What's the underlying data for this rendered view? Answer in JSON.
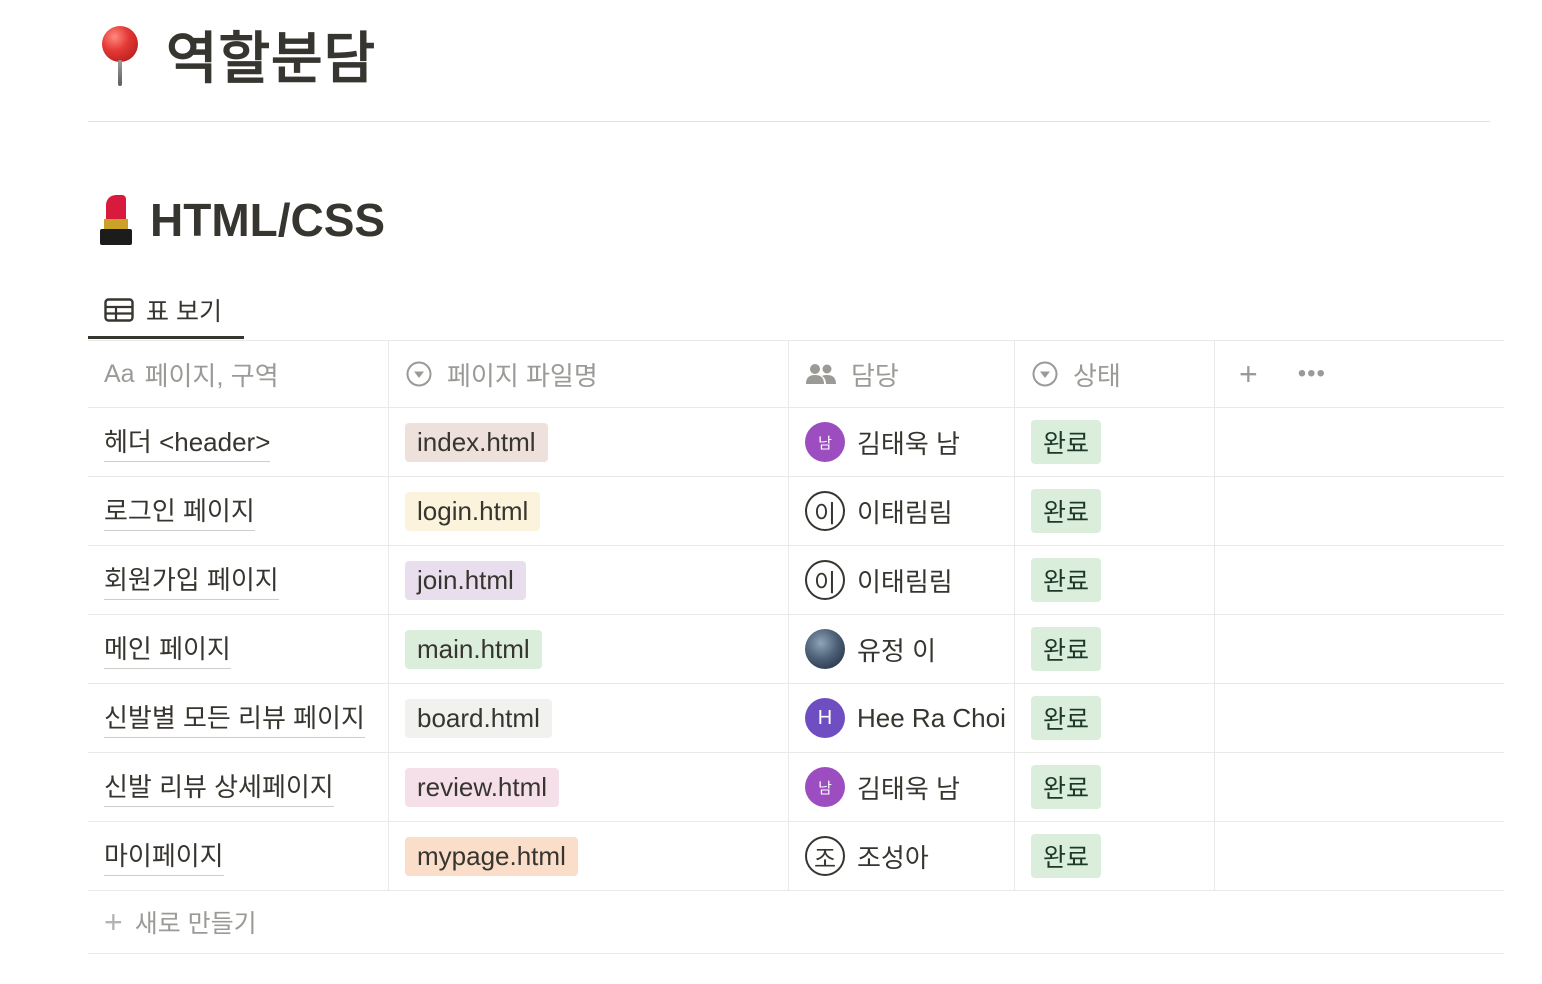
{
  "page": {
    "emoji": "pushpin-emoji",
    "title": "역할분담"
  },
  "section": {
    "emoji": "lipstick-emoji",
    "title": "HTML/CSS"
  },
  "view": {
    "tab_label": "표 보기",
    "tab_icon": "table-icon"
  },
  "table": {
    "columns": [
      {
        "prefix": "Aa",
        "label": "페이지, 구역",
        "icon": "text-property-icon"
      },
      {
        "label": "페이지 파일명",
        "icon": "select-property-icon"
      },
      {
        "label": "담당",
        "icon": "people-property-icon"
      },
      {
        "label": "상태",
        "icon": "select-property-icon"
      }
    ],
    "add_column_label": "+",
    "more_label": "•••",
    "rows": [
      {
        "title": "헤더 <header>",
        "file": "index.html",
        "file_color": "#eee0da",
        "assignee": "김태욱 남",
        "avatar_text": "남",
        "avatar_style": "purple",
        "status": "완료"
      },
      {
        "title": "로그인 페이지",
        "file": "login.html",
        "file_color": "#fbf3db",
        "assignee": "이태림림",
        "avatar_text": "이",
        "avatar_style": "outline",
        "status": "완료"
      },
      {
        "title": "회원가입 페이지",
        "file": "join.html",
        "file_color": "#e8deee",
        "assignee": "이태림림",
        "avatar_text": "이",
        "avatar_style": "outline",
        "status": "완료"
      },
      {
        "title": "메인 페이지",
        "file": "main.html",
        "file_color": "#dbeddb",
        "assignee": "유정 이",
        "avatar_text": "",
        "avatar_style": "photo",
        "status": "완료"
      },
      {
        "title": "신발별 모든 리뷰 페이지",
        "file": "board.html",
        "file_color": "#f1f1ef",
        "assignee": "Hee Ra Choi",
        "avatar_text": "H",
        "avatar_style": "violet",
        "status": "완료"
      },
      {
        "title": "신발 리뷰 상세페이지",
        "file": "review.html",
        "file_color": "#f5e0e9",
        "assignee": "김태욱 남",
        "avatar_text": "남",
        "avatar_style": "purple",
        "status": "완료"
      },
      {
        "title": "마이페이지",
        "file": "mypage.html",
        "file_color": "#fadec9",
        "assignee": "조성아",
        "avatar_text": "조",
        "avatar_style": "outline",
        "status": "완료"
      }
    ],
    "new_label": "새로 만들기",
    "new_icon": "plus-icon"
  },
  "colors": {
    "status_bg": "#dbeddb",
    "avatar_purple": "#9c4ec1",
    "avatar_violet": "#6e4ec1"
  }
}
